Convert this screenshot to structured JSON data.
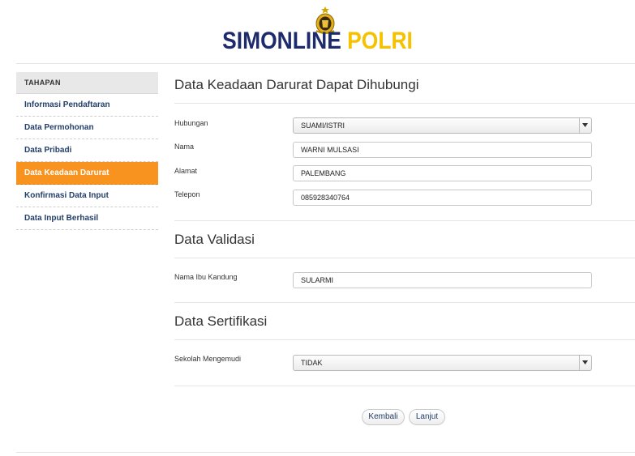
{
  "header": {
    "brand_part1": "SIMONLINE",
    "brand_part2": "POLRI",
    "colors": {
      "navy": "#1d2a6b",
      "gold": "#f6c200"
    }
  },
  "sidebar": {
    "heading": "Tahapan",
    "items": [
      {
        "label": "Informasi Pendaftaran",
        "active": false
      },
      {
        "label": "Data Permohonan",
        "active": false
      },
      {
        "label": "Data Pribadi",
        "active": false
      },
      {
        "label": "Data Keadaan Darurat",
        "active": true
      },
      {
        "label": "Konfirmasi Data Input",
        "active": false
      },
      {
        "label": "Data Input Berhasil",
        "active": false
      }
    ],
    "active_color": "#f7931e"
  },
  "emergency": {
    "title": "Data Keadaan Darurat Dapat Dihubungi",
    "hubungan_label": "Hubungan",
    "hubungan_value": "SUAMI/ISTRI",
    "nama_label": "Nama",
    "nama_value": "WARNI MULSASI",
    "alamat_label": "Alamat",
    "alamat_value": "PALEMBANG",
    "telepon_label": "Telepon",
    "telepon_value": "085928340764"
  },
  "validation": {
    "title": "Data Validasi",
    "ibu_label": "Nama Ibu Kandung",
    "ibu_value": "SULARMI"
  },
  "certification": {
    "title": "Data Sertifikasi",
    "sekolah_label": "Sekolah Mengemudi",
    "sekolah_value": "TIDAK"
  },
  "buttons": {
    "back": "Kembali",
    "next": "Lanjut"
  }
}
